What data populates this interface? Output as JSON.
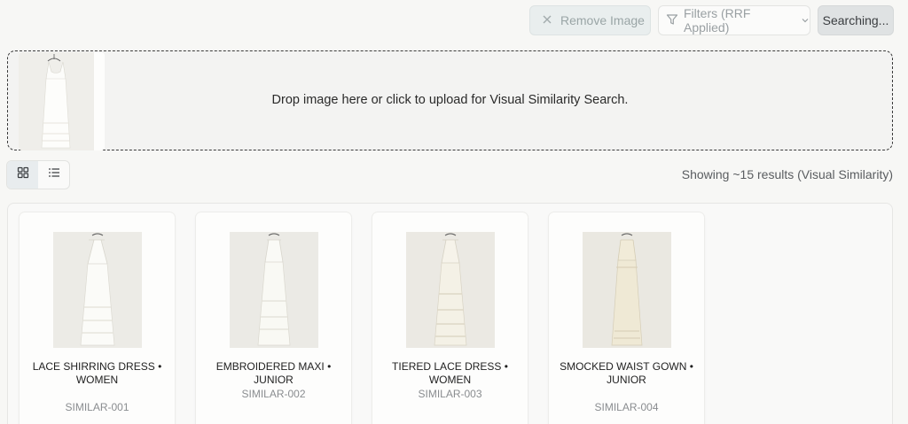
{
  "toolbar": {
    "remove_label": "Remove Image",
    "filters_label": "Filters (RRF Applied)",
    "search_label": "Searching..."
  },
  "dropzone": {
    "text": "Drop image here or click to upload for Visual Similarity Search."
  },
  "results": {
    "summary": "Showing ~15 results (Visual Similarity)",
    "items": [
      {
        "title": "LACE SHIRRING DRESS • WOMEN",
        "id": "SIMILAR-001"
      },
      {
        "title": "EMBROIDERED MAXI • JUNIOR",
        "id": "SIMILAR-002"
      },
      {
        "title": "TIERED LACE DRESS • WOMEN",
        "id": "SIMILAR-003"
      },
      {
        "title": "SMOCKED WAIST GOWN • JUNIOR",
        "id": "SIMILAR-004"
      }
    ]
  },
  "colors": {
    "accent": "#e9eeee",
    "dress_white": "#fbfbf8",
    "dress_ivory": "#f1ebd8"
  },
  "icons": [
    "close-icon",
    "filter-icon",
    "chevron-down-icon",
    "grid-view-icon",
    "list-view-icon"
  ]
}
